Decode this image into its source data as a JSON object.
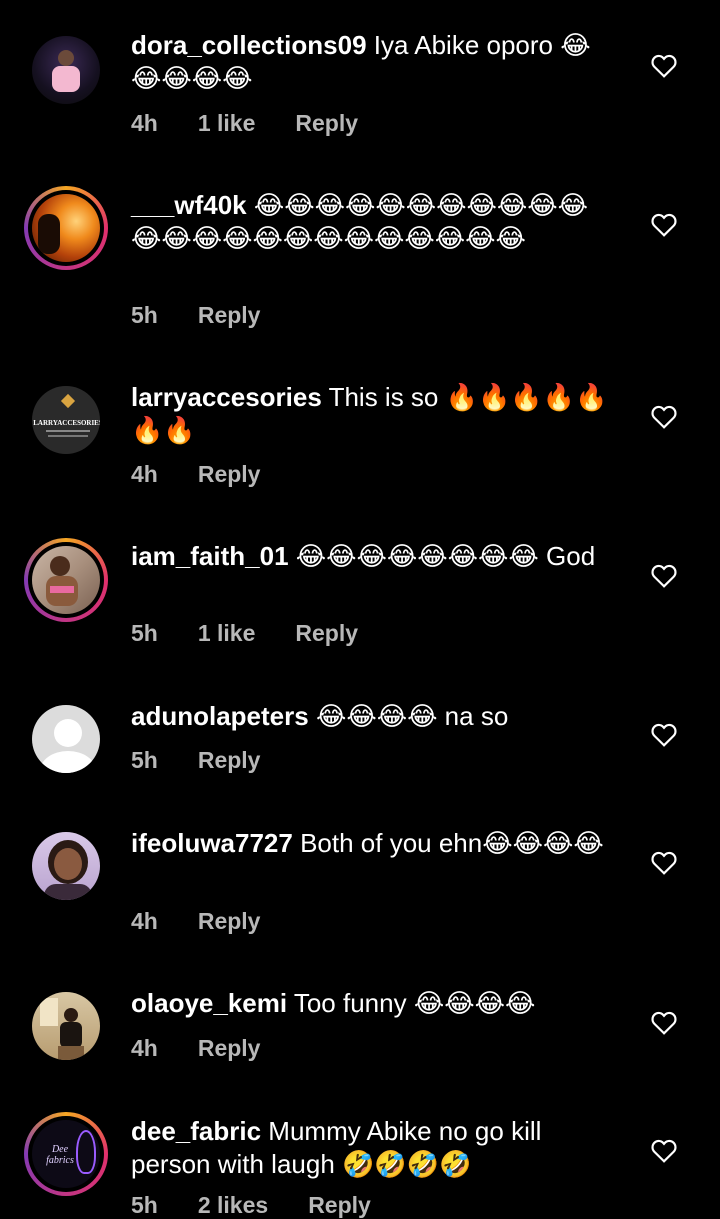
{
  "comments": [
    {
      "username": "dora_collections09",
      "text": " Iya Abike oporo 😂😂😂😂😂",
      "time": "4h",
      "likes": "1 like",
      "reply": "Reply"
    },
    {
      "username": "___wf40k",
      "text": " 😂😂😂😂😂😂😂😂😂😂😂😂😂😂😂😂😂😂😂😂😂😂😂😂",
      "time": "5h",
      "likes": "",
      "reply": "Reply"
    },
    {
      "username": "larryaccesories",
      "text": " This is so 🔥🔥🔥🔥🔥🔥🔥",
      "time": "4h",
      "likes": "",
      "reply": "Reply",
      "avatar_text": "LARRYACCESORIES"
    },
    {
      "username": "iam_faith_01",
      "text": " 😂😂😂😂😂😂😂😂 God",
      "time": "5h",
      "likes": "1 like",
      "reply": "Reply"
    },
    {
      "username": "adunolapeters",
      "text": " 😂😂😂😂 na so",
      "time": "5h",
      "likes": "",
      "reply": "Reply"
    },
    {
      "username": "ifeoluwa7727",
      "text": " Both of you ehn😂😂😂😂",
      "time": "4h",
      "likes": "",
      "reply": "Reply"
    },
    {
      "username": "olaoye_kemi",
      "text": " Too funny 😂😂😂😂",
      "time": "4h",
      "likes": "",
      "reply": "Reply"
    },
    {
      "username": "dee_fabric",
      "text": " Mummy Abike no go kill person with laugh 🤣🤣🤣🤣",
      "time": "5h",
      "likes": "2 likes",
      "reply": "Reply",
      "avatar_text": "Dee fabrics"
    }
  ]
}
